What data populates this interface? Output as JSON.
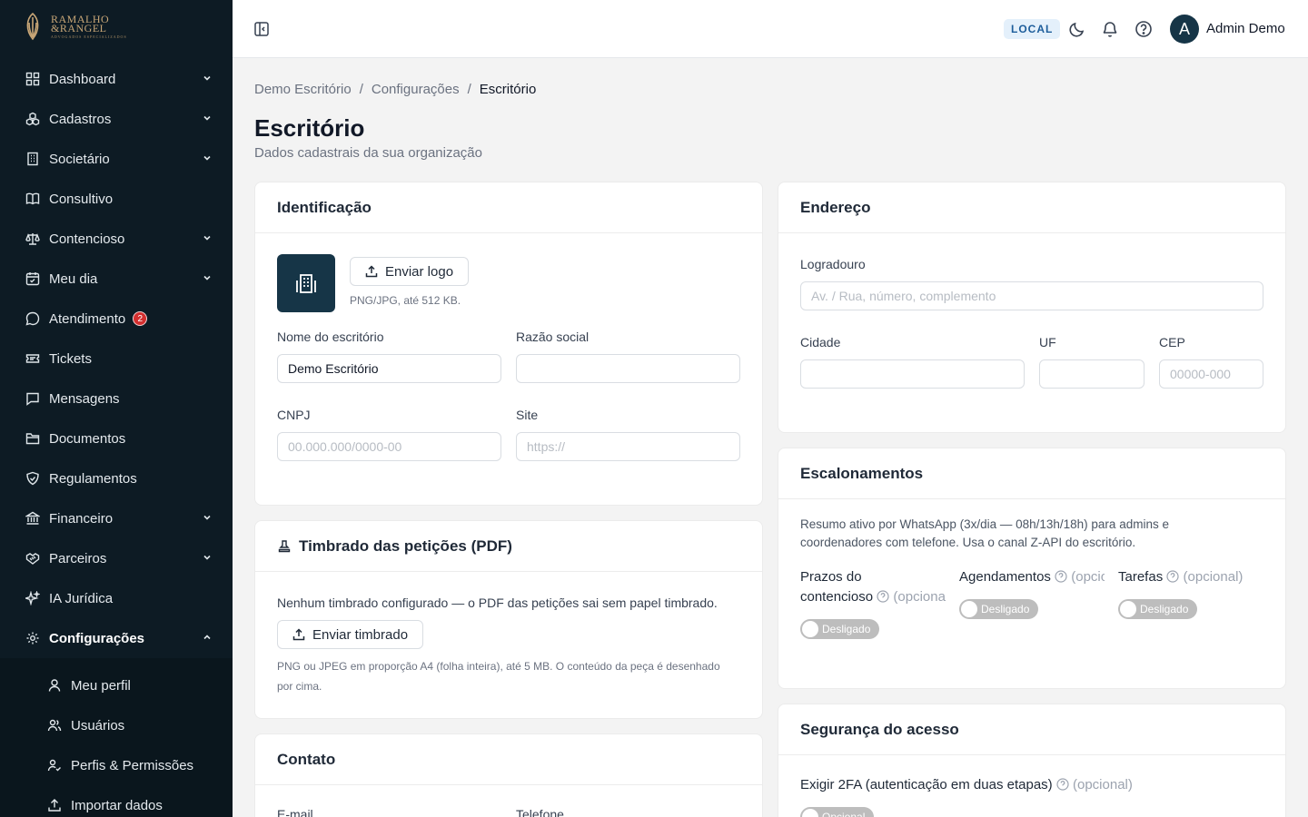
{
  "brand": {
    "line1": "RAMALHO",
    "line2": "&RANGEL",
    "tagline": "ADVOGADOS ESPECIALIZADOS"
  },
  "sidebar": {
    "items": [
      {
        "label": "Dashboard",
        "icon": "dashboard-icon",
        "expandable": true
      },
      {
        "label": "Cadastros",
        "icon": "cubes-icon",
        "expandable": true
      },
      {
        "label": "Societário",
        "icon": "building-icon",
        "expandable": true
      },
      {
        "label": "Consultivo",
        "icon": "book-icon",
        "expandable": false
      },
      {
        "label": "Contencioso",
        "icon": "scale-icon",
        "expandable": true
      },
      {
        "label": "Meu dia",
        "icon": "calendar-icon",
        "expandable": true
      },
      {
        "label": "Atendimento",
        "icon": "chat-icon",
        "expandable": false,
        "badge": "2"
      },
      {
        "label": "Tickets",
        "icon": "ticket-icon",
        "expandable": false
      },
      {
        "label": "Mensagens",
        "icon": "message-icon",
        "expandable": false
      },
      {
        "label": "Documentos",
        "icon": "folder-icon",
        "expandable": false
      },
      {
        "label": "Regulamentos",
        "icon": "shield-icon",
        "expandable": false
      },
      {
        "label": "Financeiro",
        "icon": "bank-icon",
        "expandable": true
      },
      {
        "label": "Parceiros",
        "icon": "handshake-icon",
        "expandable": true
      },
      {
        "label": "IA Jurídica",
        "icon": "sparkles-icon",
        "expandable": false
      },
      {
        "label": "Configurações",
        "icon": "gear-icon",
        "expandable": true,
        "expanded": true
      }
    ],
    "subitems": [
      {
        "label": "Meu perfil",
        "icon": "user-icon"
      },
      {
        "label": "Usuários",
        "icon": "users-icon"
      },
      {
        "label": "Perfis & Permissões",
        "icon": "user-check-icon"
      },
      {
        "label": "Importar dados",
        "icon": "upload-icon"
      }
    ]
  },
  "topbar": {
    "env": "LOCAL",
    "avatar_initial": "A",
    "user_name": "Admin Demo"
  },
  "breadcrumb": {
    "root": "Demo Escritório",
    "parent": "Configurações",
    "current": "Escritório",
    "sep": "/"
  },
  "page": {
    "title": "Escritório",
    "subtitle": "Dados cadastrais da sua organização"
  },
  "identificacao": {
    "title": "Identificação",
    "upload_logo": "Enviar logo",
    "logo_hint": "PNG/JPG, até 512 KB.",
    "nome_label": "Nome do escritório",
    "nome_value": "Demo Escritório",
    "razao_label": "Razão social",
    "razao_value": "",
    "cnpj_label": "CNPJ",
    "cnpj_placeholder": "00.000.000/0000-00",
    "site_label": "Site",
    "site_placeholder": "https://"
  },
  "timbrado": {
    "title": "Timbrado das petições (PDF)",
    "status": "Nenhum timbrado configurado — o PDF das petições sai sem papel timbrado.",
    "upload": "Enviar timbrado",
    "hint": "PNG ou JPEG em proporção A4 (folha inteira), até 5 MB. O conteúdo da peça é desenhado por cima."
  },
  "contato": {
    "title": "Contato",
    "email_label": "E-mail",
    "telefone_label": "Telefone"
  },
  "endereco": {
    "title": "Endereço",
    "logradouro_label": "Logradouro",
    "logradouro_placeholder": "Av. / Rua, número, complemento",
    "cidade_label": "Cidade",
    "uf_label": "UF",
    "cep_label": "CEP",
    "cep_placeholder": "00000-000"
  },
  "escalonamentos": {
    "title": "Escalonamentos",
    "description": "Resumo ativo por WhatsApp (3x/dia — 08h/13h/18h) para admins e coordenadores com telefone. Usa o canal Z-API do escritório.",
    "toggles": [
      {
        "label_a": "Prazos do",
        "label_b": "contencioso",
        "optional": "(opcional)",
        "state": "Desligado"
      },
      {
        "label_a": "Agendamentos",
        "optional": "(opcional)",
        "state": "Desligado"
      },
      {
        "label_a": "Tarefas",
        "optional": "(opcional)",
        "state": "Desligado"
      }
    ]
  },
  "seguranca": {
    "title": "Segurança do acesso",
    "label": "Exigir 2FA (autenticação em duas etapas)",
    "optional": "(opcional)",
    "state": "Opcional"
  }
}
